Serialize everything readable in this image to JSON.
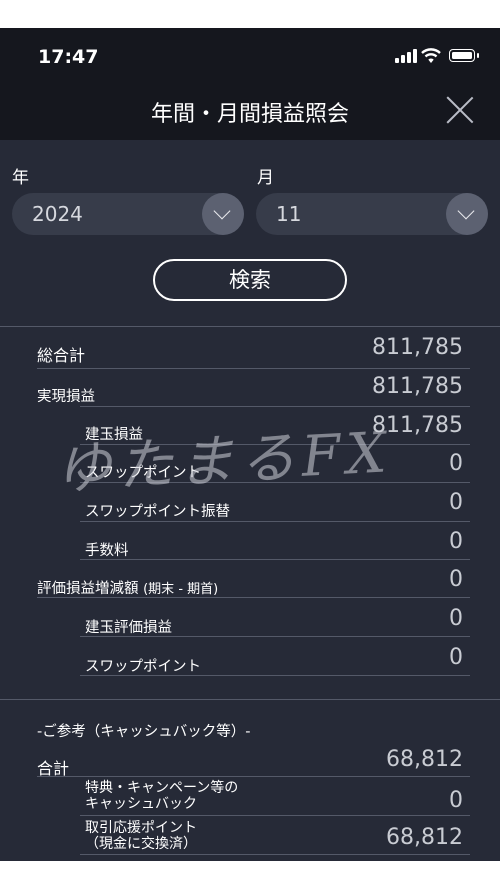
{
  "status_bar": {
    "time": "17:47"
  },
  "header": {
    "title": "年間・月間損益照会"
  },
  "filters": {
    "year_label": "年",
    "year_value": "2024",
    "month_label": "月",
    "month_value": "11",
    "search_label": "検索"
  },
  "summary": {
    "total": {
      "label": "総合計",
      "value": "811,785"
    },
    "realized": {
      "label": "実現損益",
      "value": "811,785"
    },
    "position_pl": {
      "label": "建玉損益",
      "value": "811,785"
    },
    "swap": {
      "label": "スワップポイント",
      "value": "0"
    },
    "swap_transfer": {
      "label": "スワップポイント振替",
      "value": "0"
    },
    "fee": {
      "label": "手数料",
      "value": "0"
    },
    "valuation": {
      "label": "評価損益増減額",
      "label_paren": "(期末 - 期首)",
      "value": "0"
    },
    "position_valuation": {
      "label": "建玉評価損益",
      "value": "0"
    },
    "valuation_swap": {
      "label": "スワップポイント",
      "value": "0"
    }
  },
  "reference": {
    "title": "-ご参考（キャッシュバック等）-",
    "total": {
      "label": "合計",
      "value": "68,812"
    },
    "cashback": {
      "label_line1": "特典・キャンペーン等の",
      "label_line2": "キャッシュバック",
      "value": "0"
    },
    "points": {
      "label_line1": "取引応援ポイント",
      "label_line2": "（現金に交換済）",
      "value": "68,812"
    }
  },
  "watermark": "ゆたまるFX"
}
